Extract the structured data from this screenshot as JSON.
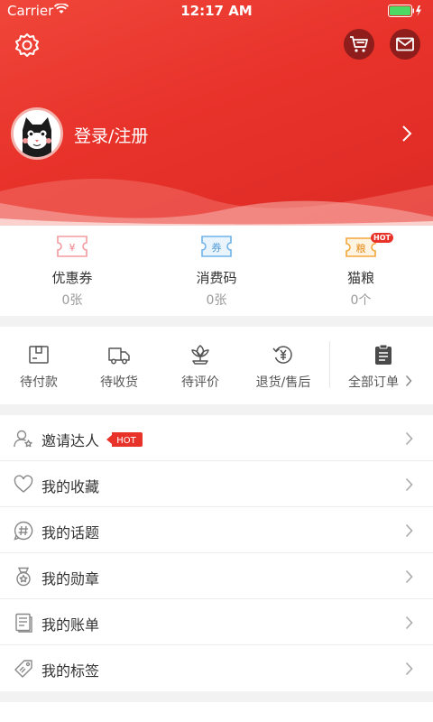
{
  "status_bar": {
    "carrier": "Carrier",
    "time": "12:17 AM"
  },
  "profile": {
    "login_label": "登录/注册"
  },
  "assets": [
    {
      "icon_text": "¥",
      "label": "优惠券",
      "count": "0张",
      "icon": "coupon-icon"
    },
    {
      "icon_text": "券",
      "label": "消费码",
      "count": "0张",
      "icon": "voucher-icon"
    },
    {
      "icon_text": "粮",
      "label": "猫粮",
      "count": "0个",
      "icon": "cat-food-icon",
      "badge": "HOT"
    }
  ],
  "orders": [
    {
      "label": "待付款",
      "icon": "wallet-icon"
    },
    {
      "label": "待收货",
      "icon": "truck-icon"
    },
    {
      "label": "待评价",
      "icon": "flower-icon"
    },
    {
      "label": "退货/售后",
      "icon": "refund-icon"
    },
    {
      "label": "全部订单",
      "icon": "clipboard-icon"
    }
  ],
  "menu": [
    {
      "label": "邀请达人",
      "icon": "invite-user-icon",
      "badge": "HOT"
    },
    {
      "label": "我的收藏",
      "icon": "heart-icon"
    },
    {
      "label": "我的话题",
      "icon": "topic-hash-icon"
    },
    {
      "label": "我的勋章",
      "icon": "medal-icon"
    },
    {
      "label": "我的账单",
      "icon": "bill-icon"
    },
    {
      "label": "我的标签",
      "icon": "tag-icon"
    }
  ],
  "colors": {
    "brand": "#e8332b",
    "dark_red": "#8e1d1b"
  }
}
